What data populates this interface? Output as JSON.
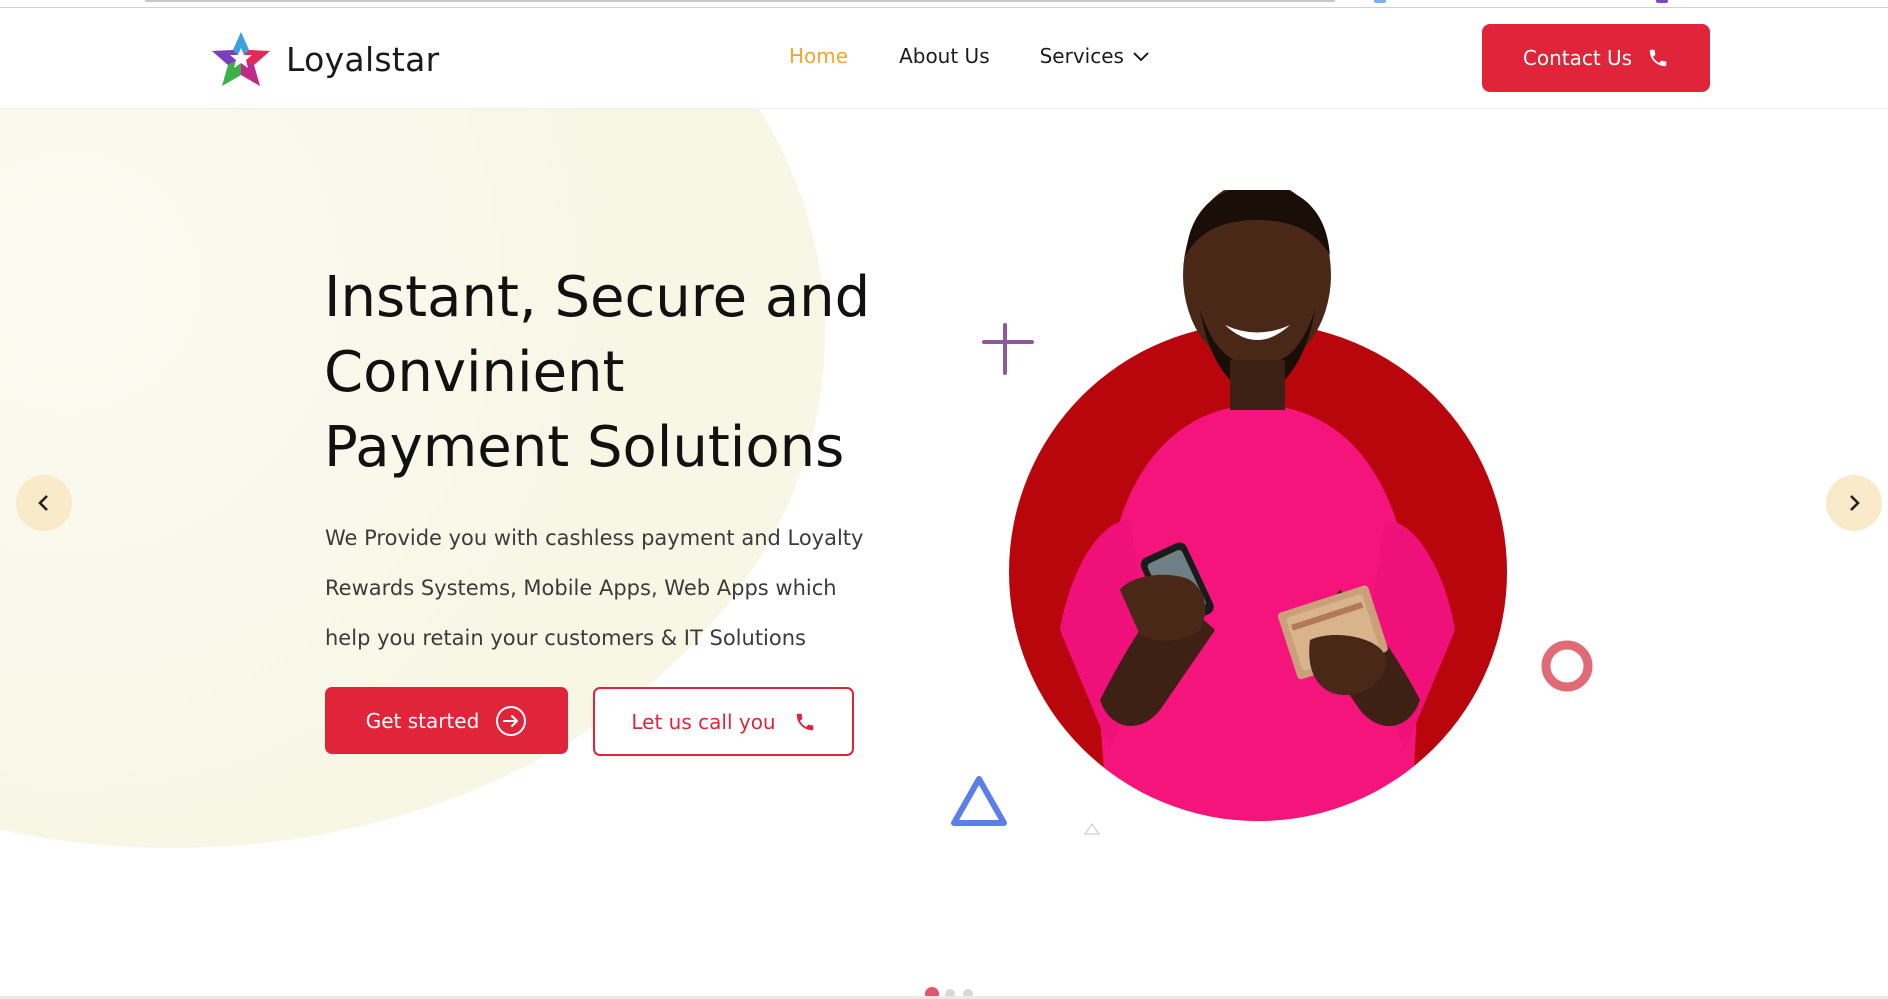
{
  "brand": {
    "name": "Loyalstar",
    "logo_icon": "star-logo-icon"
  },
  "nav": {
    "items": [
      {
        "label": "Home",
        "active": true
      },
      {
        "label": "About Us",
        "active": false
      },
      {
        "label": "Services",
        "active": false,
        "icon": "chevron-down-icon"
      }
    ]
  },
  "header": {
    "contact_label": "Contact Us",
    "contact_icon": "phone-icon"
  },
  "hero": {
    "title_lines": [
      "Instant, Secure and",
      "Convinient",
      "Payment Solutions"
    ],
    "description": "We Provide you with cashless payment and Loyalty Rewards Systems, Mobile Apps, Web Apps which help you retain your customers & IT Solutions",
    "primary_button": {
      "label": "Get started",
      "icon": "arrow-right-circle-icon"
    },
    "secondary_button": {
      "label": "Let us call you",
      "icon": "phone-icon"
    }
  },
  "carousel": {
    "slides": 3,
    "active_slide": 1
  },
  "colors": {
    "accent": "#e0243a",
    "nav_active": "#f4a52b",
    "arrow_bg": "#f9ebc9",
    "hero_blob": "#f8f6e2",
    "circle_red": "#b8060c",
    "shirt_pink": "#f5147c",
    "deco_plus": "#8a5a9a",
    "deco_ring": "#e06a76",
    "deco_triangle": "#5b7fe6"
  }
}
